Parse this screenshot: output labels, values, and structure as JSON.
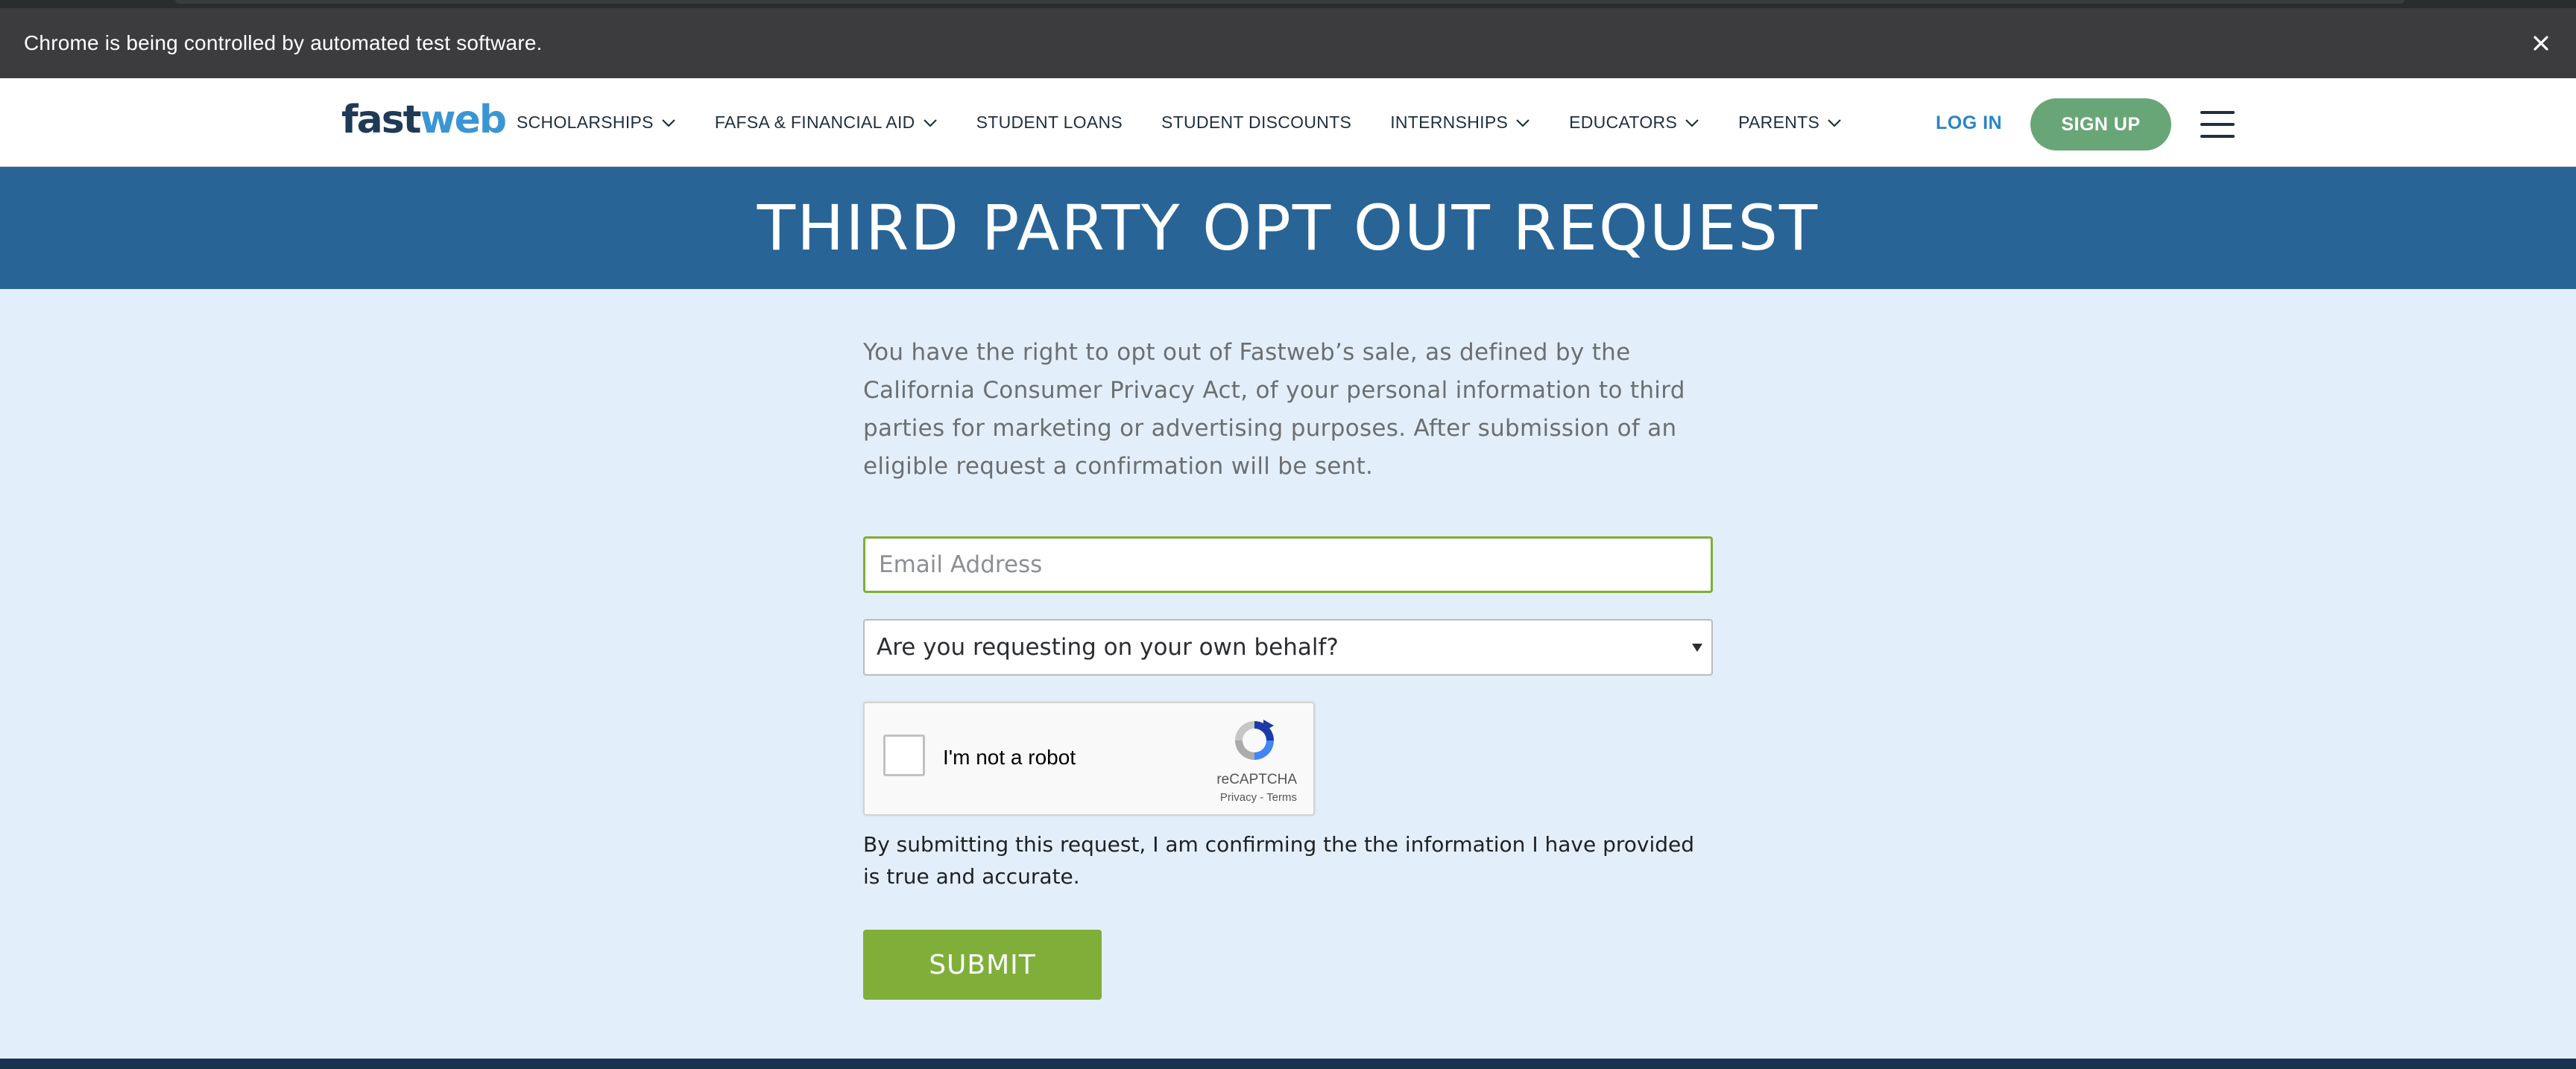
{
  "browser": {
    "infobar_text": "Chrome is being controlled by automated test software.",
    "close_icon": "close-icon"
  },
  "header": {
    "logo": {
      "part1": "fast",
      "part2": "web"
    },
    "nav": [
      {
        "label": "SCHOLARSHIPS",
        "has_dropdown": true
      },
      {
        "label": "FAFSA & FINANCIAL AID",
        "has_dropdown": true
      },
      {
        "label": "STUDENT LOANS",
        "has_dropdown": false
      },
      {
        "label": "STUDENT DISCOUNTS",
        "has_dropdown": false
      },
      {
        "label": "INTERNSHIPS",
        "has_dropdown": true
      },
      {
        "label": "EDUCATORS",
        "has_dropdown": true
      },
      {
        "label": "PARENTS",
        "has_dropdown": true
      }
    ],
    "login_label": "LOG IN",
    "signup_label": "SIGN UP",
    "menu_icon": "hamburger-menu-icon"
  },
  "page": {
    "title": "THIRD PARTY OPT OUT REQUEST",
    "intro": "You have the right to opt out of Fastweb’s sale, as defined by the California Consumer Privacy Act, of your personal information to third parties for marketing or advertising purposes. After submission of an eligible request a confirmation will be sent."
  },
  "form": {
    "email": {
      "value": "",
      "placeholder": "Email Address"
    },
    "behalf_select": {
      "selected": "Are you requesting on your own behalf?"
    },
    "recaptcha": {
      "label": "I'm not a robot",
      "brand": "reCAPTCHA",
      "privacy_link": "Privacy",
      "separator": " - ",
      "terms_link": "Terms",
      "checked": false
    },
    "confirm_text": "By submitting this request, I am confirming the the information I have provided is true and accurate.",
    "submit_label": "SUBMIT"
  },
  "colors": {
    "title_band": "#296496",
    "page_bg": "#e2effa",
    "submit": "#7faf39",
    "signup": "#69a677",
    "login_link": "#2a85c4",
    "email_focus_border": "#7fae33"
  }
}
